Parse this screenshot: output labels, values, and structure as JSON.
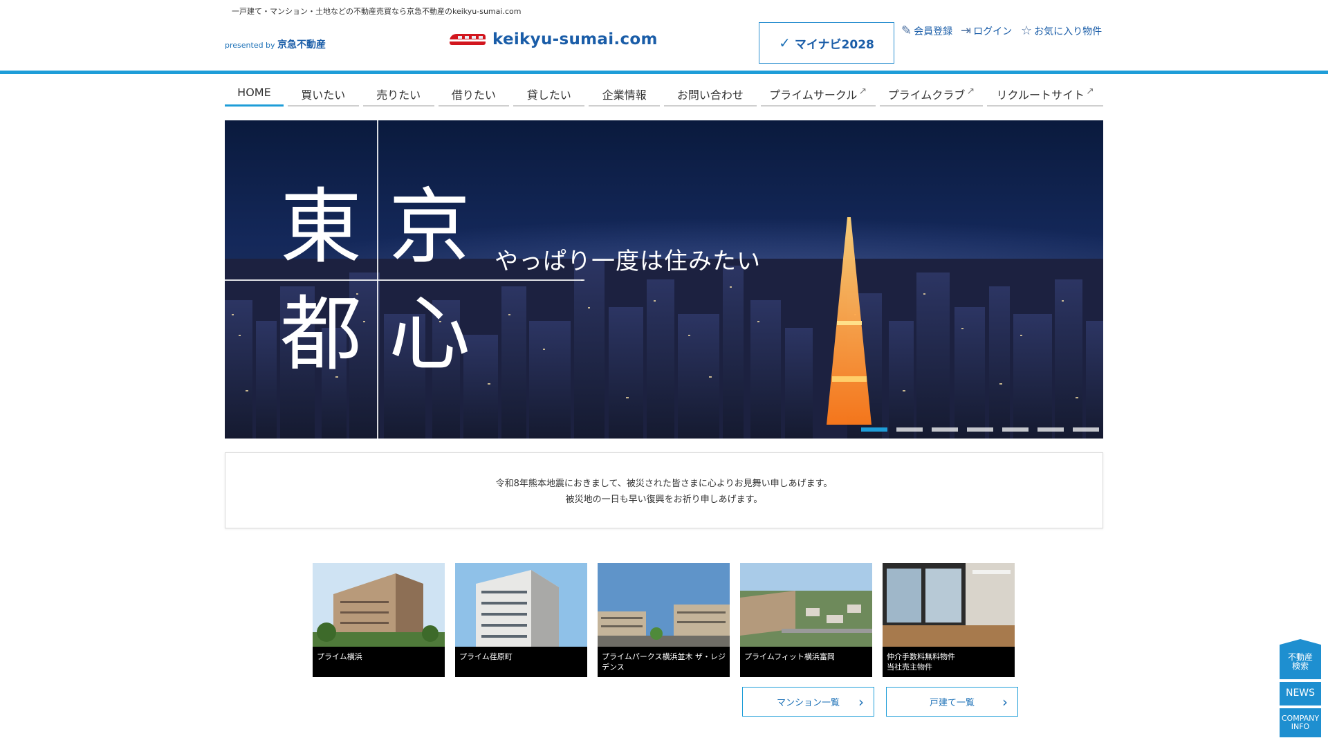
{
  "header": {
    "tagline": "一戸建て・マンション・土地などの不動産売買なら京急不動産のkeikyu-sumai.com",
    "presented_by": "presented by",
    "company": "京急不動産",
    "logo_text": "keikyu-sumai.com",
    "mynavi_label": "マイナビ2028",
    "utility_links": [
      {
        "label": "会員登録",
        "icon": "pencil-icon"
      },
      {
        "label": "ログイン",
        "icon": "login-icon"
      },
      {
        "label": "お気に入り物件",
        "icon": "star-icon"
      }
    ]
  },
  "nav": {
    "items": [
      {
        "label": "HOME",
        "external": false,
        "active": true
      },
      {
        "label": "買いたい",
        "external": false,
        "active": false
      },
      {
        "label": "売りたい",
        "external": false,
        "active": false
      },
      {
        "label": "借りたい",
        "external": false,
        "active": false
      },
      {
        "label": "貸したい",
        "external": false,
        "active": false
      },
      {
        "label": "企業情報",
        "external": false,
        "active": false
      },
      {
        "label": "お問い合わせ",
        "external": false,
        "active": false
      },
      {
        "label": "プライムサークル",
        "external": true,
        "active": false
      },
      {
        "label": "プライムクラブ",
        "external": true,
        "active": false
      },
      {
        "label": "リクルートサイト",
        "external": true,
        "active": false
      }
    ]
  },
  "hero": {
    "kanji": [
      "東",
      "京",
      "都",
      "心"
    ],
    "catch": "やっぱり一度は住みたい",
    "slide_count": 7,
    "active_slide": 1
  },
  "notice": {
    "line1": "令和8年熊本地震におきまして、被災された皆さまに心よりお見舞い申しあげます。",
    "line2": "被災地の一日も早い復興をお祈り申しあげます。"
  },
  "properties": [
    {
      "name": "プライム横浜"
    },
    {
      "name": "プライム荏原町"
    },
    {
      "name": "プライムパークス横浜並木 ザ・レジデンス"
    },
    {
      "name": "プライムフィット横浜富岡"
    },
    {
      "name": "仲介手数料無料物件\n当社売主物件"
    }
  ],
  "buttons": {
    "mansion_list": "マンション一覧",
    "house_list": "戸建て一覧"
  },
  "side": {
    "search": "不動産\n検索",
    "news": "NEWS",
    "company": "COMPANY\nINFO"
  },
  "colors": {
    "accent": "#1e9dd8",
    "brand_blue": "#1a5da8"
  }
}
